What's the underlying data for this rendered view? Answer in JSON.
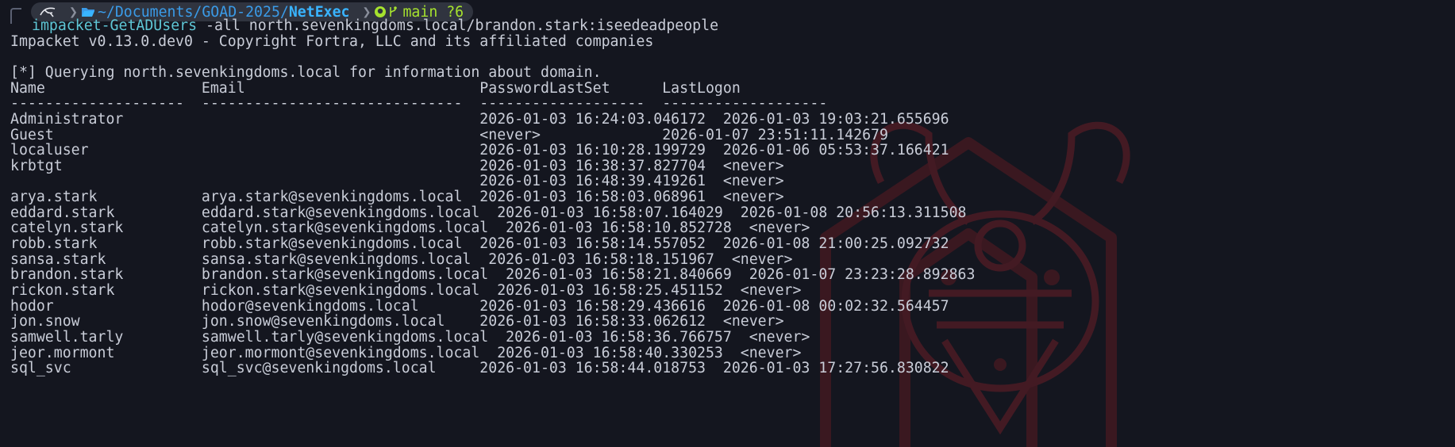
{
  "prompt": {
    "path_prefix": "~/Documents/GOAD-2025/",
    "path_current": "NetExec",
    "git_branch": "main",
    "git_status": "?6"
  },
  "command": {
    "name": "impacket-GetADUsers",
    "args": " -all north.sevenkingdoms.local/brandon.stark:iseedeadpeople"
  },
  "output": {
    "banner": "Impacket v0.13.0.dev0 - Copyright Fortra, LLC and its affiliated companies",
    "query": "[*] Querying north.sevenkingdoms.local for information about domain.",
    "header": "Name                  Email                           PasswordLastSet      LastLogon",
    "divider": "--------------------  ------------------------------  -------------------  -------------------",
    "rows": [
      "Administrator                                         2026-01-03 16:24:03.046172  2026-01-03 19:03:21.655696",
      "Guest                                                 <never>              2026-01-07 23:51:11.142679",
      "localuser                                             2026-01-03 16:10:28.199729  2026-01-06 05:53:37.166421",
      "krbtgt                                                2026-01-03 16:38:37.827704  <never>",
      "                                                      2026-01-03 16:48:39.419261  <never>",
      "arya.stark            arya.stark@sevenkingdoms.local  2026-01-03 16:58:03.068961  <never>",
      "eddard.stark          eddard.stark@sevenkingdoms.local  2026-01-03 16:58:07.164029  2026-01-08 20:56:13.311508",
      "catelyn.stark         catelyn.stark@sevenkingdoms.local  2026-01-03 16:58:10.852728  <never>",
      "robb.stark            robb.stark@sevenkingdoms.local  2026-01-03 16:58:14.557052  2026-01-08 21:00:25.092732",
      "sansa.stark           sansa.stark@sevenkingdoms.local  2026-01-03 16:58:18.151967  <never>",
      "brandon.stark         brandon.stark@sevenkingdoms.local  2026-01-03 16:58:21.840669  2026-01-07 23:23:28.892863",
      "rickon.stark          rickon.stark@sevenkingdoms.local  2026-01-03 16:58:25.451152  <never>",
      "hodor                 hodor@sevenkingdoms.local       2026-01-03 16:58:29.436616  2026-01-08 00:02:32.564457",
      "jon.snow              jon.snow@sevenkingdoms.local    2026-01-03 16:58:33.062612  <never>",
      "samwell.tarly         samwell.tarly@sevenkingdoms.local  2026-01-03 16:58:36.766757  <never>",
      "jeor.mormont          jeor.mormont@sevenkingdoms.local  2026-01-03 16:58:40.330253  <never>",
      "sql_svc               sql_svc@sevenkingdoms.local     2026-01-03 16:58:44.018753  2026-01-03 17:27:56.830822"
    ]
  },
  "colors": {
    "background": "#14161f",
    "text": "#c9cdd8",
    "command": "#5fc7d6",
    "path": "#39b4ff",
    "git": "#a6e22e",
    "watermark": "#5a1a22"
  }
}
